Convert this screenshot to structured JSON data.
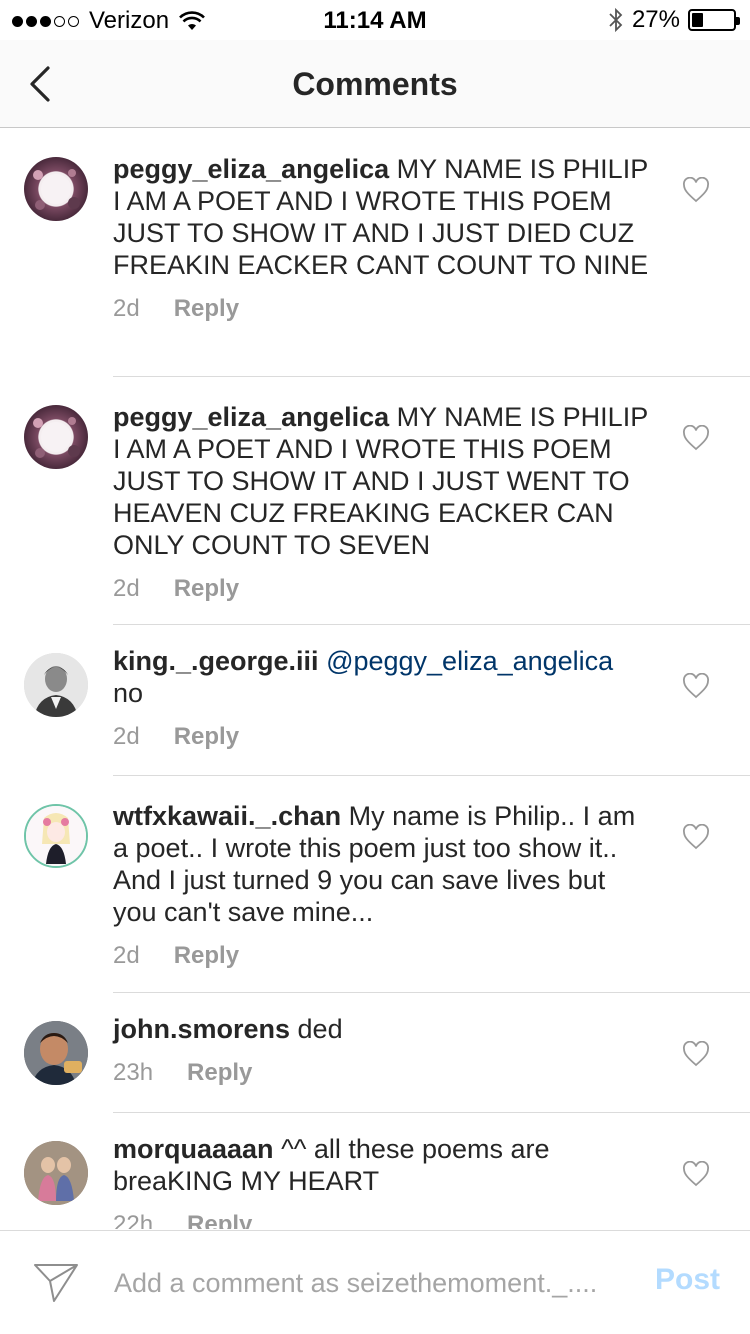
{
  "status_bar": {
    "carrier": "Verizon",
    "time": "11:14 AM",
    "battery_text": "27%",
    "battery_level": 0.27,
    "signal_dots_filled": 3,
    "signal_dots_total": 5
  },
  "header": {
    "title": "Comments",
    "back_icon": "chevron-left-icon"
  },
  "comments": [
    {
      "username": "peggy_eliza_angelica",
      "text": " MY NAME IS PHILIP I AM A POET AND I WROTE THIS POEM JUST TO SHOW IT AND I JUST DIED CUZ FREAKIN EACKER CANT COUNT TO NINE",
      "time": "2d",
      "reply": "Reply"
    },
    {
      "username": "peggy_eliza_angelica",
      "text": " MY NAME IS PHILIP I AM A POET AND I WROTE THIS POEM JUST TO SHOW IT AND I JUST WENT TO HEAVEN CUZ FREAKING EACKER CAN ONLY COUNT TO SEVEN",
      "time": "2d",
      "reply": "Reply"
    },
    {
      "username": "king._.george.iii",
      "mention": "@peggy_eliza_angelica",
      "text": "no",
      "time": "2d",
      "reply": "Reply"
    },
    {
      "username": "wtfxkawaii._.chan",
      "text": " My name is Philip.. I am a poet.. I wrote this poem just too show it.. And I just turned 9 you can save lives but you can't save mine...",
      "time": "2d",
      "reply": "Reply"
    },
    {
      "username": "john.smorens",
      "text": " ded",
      "time": "23h",
      "reply": "Reply"
    },
    {
      "username": "morquaaaan",
      "text": " ^^ all these poems are breaKING MY HEART",
      "time": "22h",
      "reply": "Reply"
    }
  ],
  "input_bar": {
    "placeholder": "Add a comment as seizethemoment._....",
    "post_label": "Post",
    "post_color": "#b3dbff"
  },
  "colors": {
    "mention": "#003569",
    "meta": "#999999",
    "text": "#262626"
  }
}
